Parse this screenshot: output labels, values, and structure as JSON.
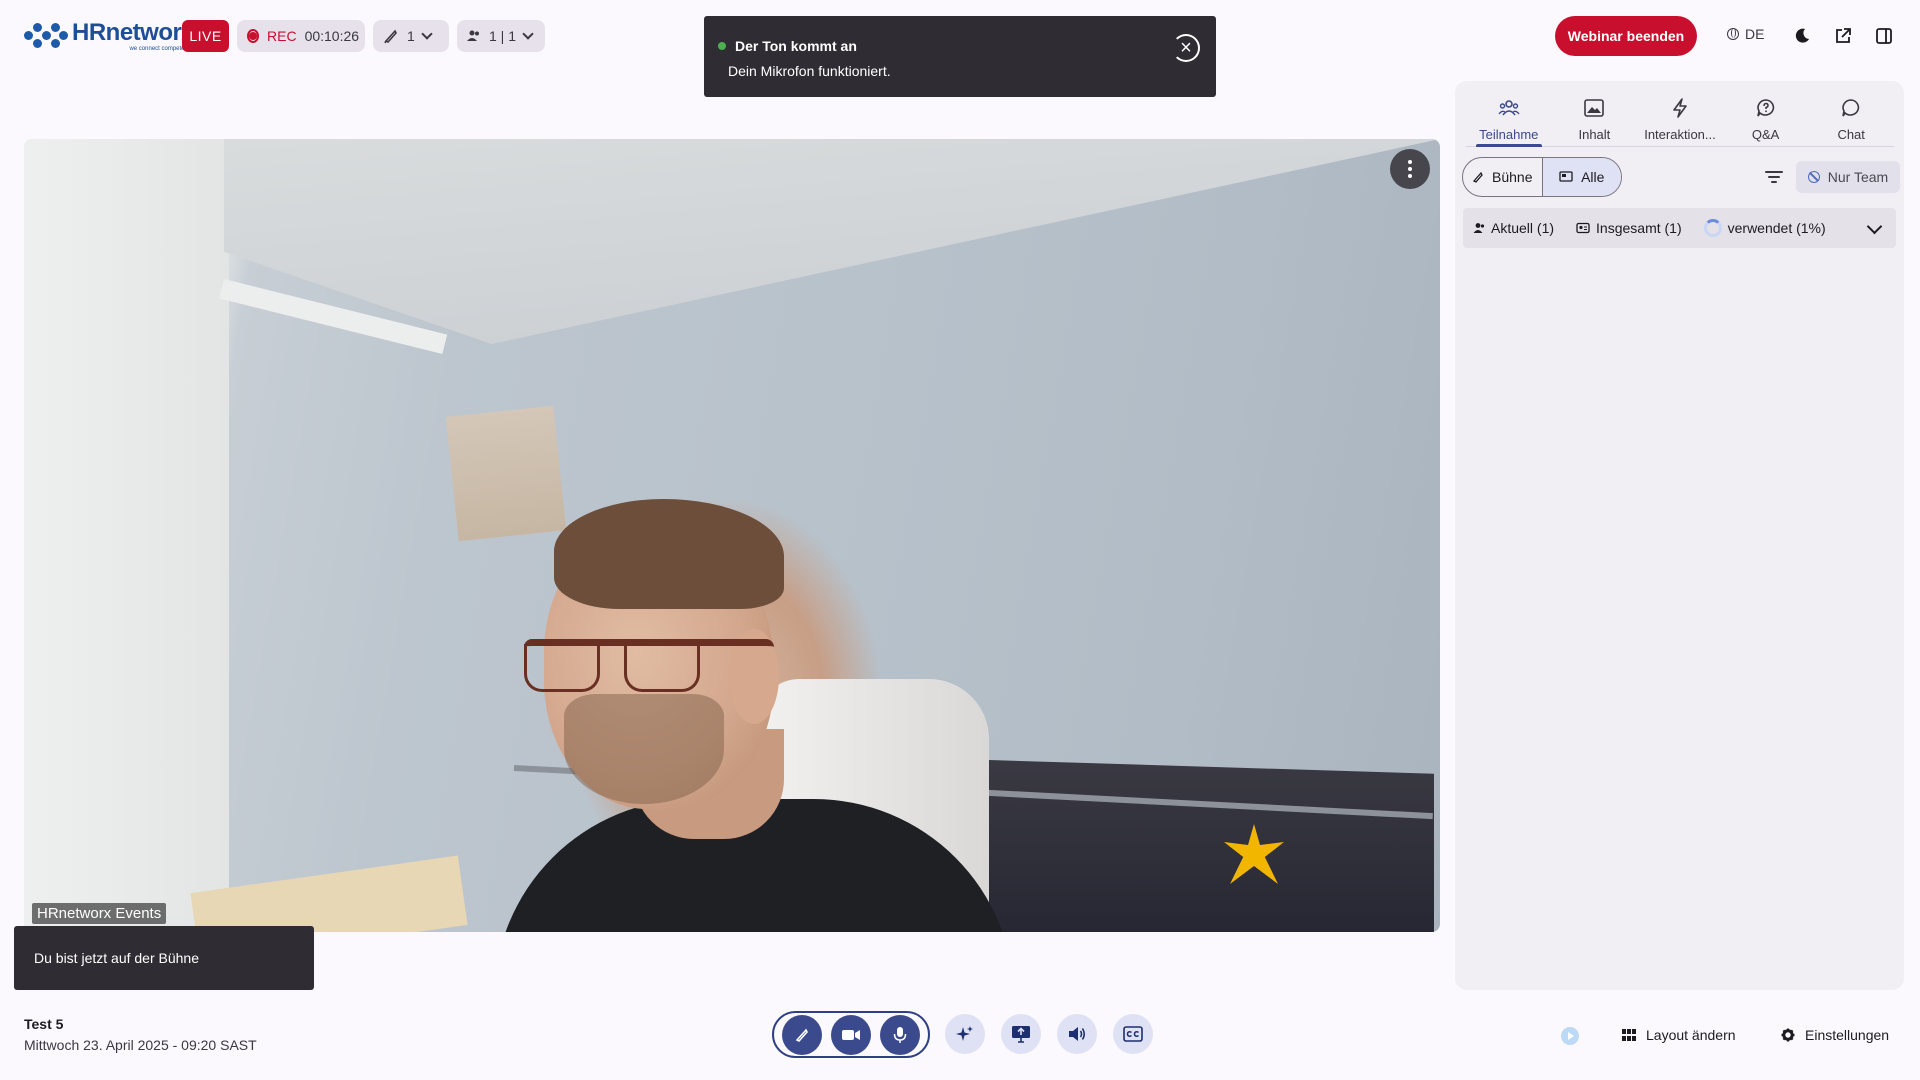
{
  "header": {
    "brand": "HRnetworx",
    "tagline": "we connect competence",
    "live_label": "LIVE",
    "rec_label": "REC",
    "rec_time": "00:10:26",
    "stage_count": "1",
    "participants": "1 | 1",
    "end_button": "Webinar beenden",
    "language": "DE"
  },
  "toast": {
    "title": "Der Ton kommt an",
    "message": "Dein Mikrofon funktioniert."
  },
  "video": {
    "participant_name": "HRnetworx Events"
  },
  "snackbar": {
    "message": "Du bist jetzt auf der Bühne"
  },
  "panel": {
    "tabs": [
      {
        "label": "Teilnahme",
        "icon": "people-icon",
        "active": true
      },
      {
        "label": "Inhalt",
        "icon": "image-icon",
        "active": false
      },
      {
        "label": "Interaktion...",
        "icon": "bolt-icon",
        "active": false
      },
      {
        "label": "Q&A",
        "icon": "question-bubble-icon",
        "active": false
      },
      {
        "label": "Chat",
        "icon": "chat-bubble-icon",
        "active": false
      }
    ],
    "segments": [
      "Bühne",
      "Alle"
    ],
    "team_filter": "Nur Team",
    "stats": {
      "current": "Aktuell (1)",
      "total": "Insgesamt (1)",
      "used": "verwendet (1%)"
    }
  },
  "footer": {
    "event_title": "Test 5",
    "event_date": "Mittwoch 23. April 2025 - 09:20 SAST",
    "layout_label": "Layout ändern",
    "settings_label": "Einstellungen"
  },
  "colors": {
    "accent": "#3a4a8c",
    "live_red": "#c8102e",
    "toast_bg": "#2f2d33",
    "mic_ok": "#4caf50"
  }
}
